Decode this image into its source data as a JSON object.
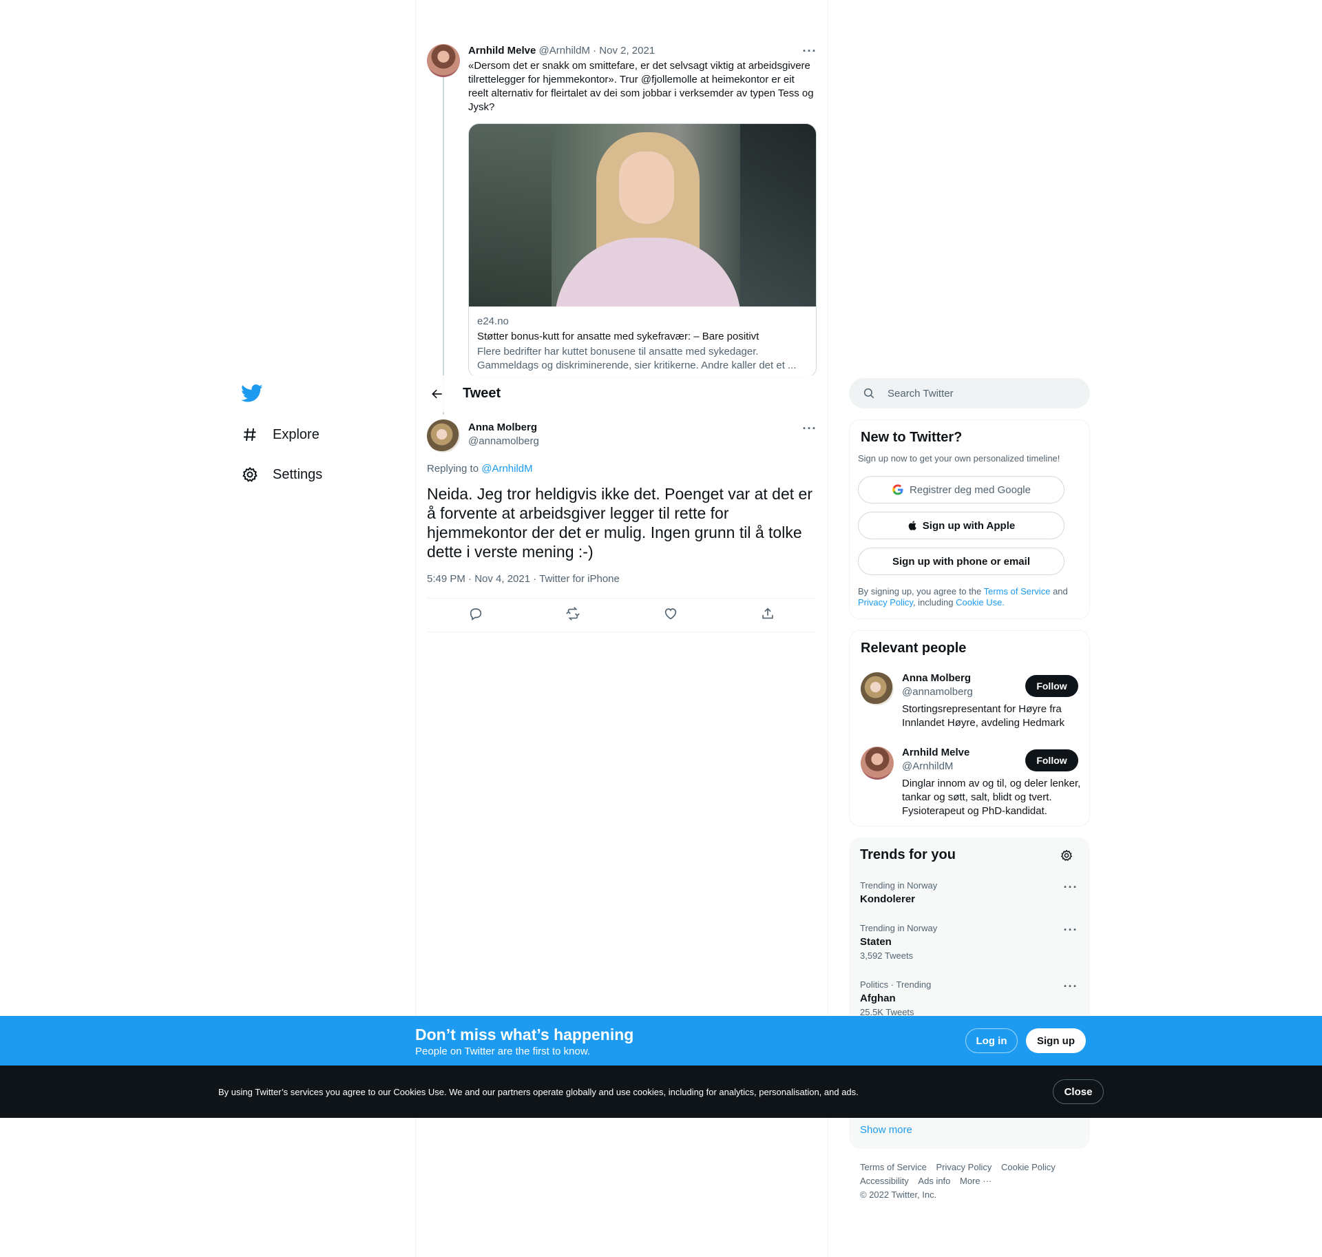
{
  "nav": {
    "explore_label": "Explore",
    "settings_label": "Settings"
  },
  "parent_tweet": {
    "author_name": "Arnhild Melve",
    "handle_date": "@ArnhildM · Nov 2, 2021",
    "text": "«Dersom det er snakk om smittefare, er det selvsagt viktig at arbeidsgivere tilrettelegger for hjemmekontor». Trur @fjollemolle at heimekontor er eit reelt alternativ for fleirtalet av dei som jobbar i verksemder av typen Tess og Jysk?",
    "card": {
      "domain": "e24.no",
      "title": "Støtter bonus-kutt for ansatte med sykefravær: – Bare positivt",
      "description": "Flere bedrifter har kuttet bonusene til ansatte med sykedager. Gammeldags og diskriminerende, sier kritikerne. Andre kaller det et ..."
    }
  },
  "header": {
    "title": "Tweet"
  },
  "focal_tweet": {
    "author_name": "Anna Molberg",
    "handle": "@annamolberg",
    "replying_prefix": "Replying to",
    "replying_to": "@ArnhildM",
    "text": "Neida. Jeg tror heldigvis ikke det. Poenget var at det er å forvente at arbeidsgiver legger til rette for hjemmekontor der det er mulig. Ingen grunn til å tolke dette i verste mening :-)",
    "meta": "5:49 PM · Nov 4, 2021 · Twitter for iPhone"
  },
  "search": {
    "placeholder": "Search Twitter"
  },
  "new_to_twitter": {
    "title": "New to Twitter?",
    "subtitle": "Sign up now to get your own personalized timeline!",
    "google_label": "Registrer deg med Google",
    "apple_label": "Sign up with Apple",
    "phone_label": "Sign up with phone or email",
    "legal_prefix": "By signing up, you agree to the",
    "terms": "Terms of Service",
    "and": "and",
    "privacy": "Privacy Policy",
    "including": ", including",
    "cookie": "Cookie Use."
  },
  "relevant_people": {
    "title": "Relevant people",
    "people": [
      {
        "name": "Anna Molberg",
        "handle": "@annamolberg",
        "bio": "Stortingsrepresentant for Høyre fra Innlandet Høyre, avdeling Hedmark",
        "follow_label": "Follow"
      },
      {
        "name": "Arnhild Melve",
        "handle": "@ArnhildM",
        "bio": "Dinglar innom av og til, og deler lenker, tankar og søtt, salt, blidt og tvert. Fysioterapeut og PhD-kandidat.",
        "follow_label": "Follow"
      }
    ]
  },
  "trends": {
    "title": "Trends for you",
    "items": [
      {
        "context": "Trending in Norway",
        "name": "Kondolerer",
        "count": ""
      },
      {
        "context": "Trending in Norway",
        "name": "Staten",
        "count": "3,592 Tweets"
      },
      {
        "context": "Politics · Trending",
        "name": "Afghan",
        "count": "25.5K Tweets"
      }
    ],
    "show_more": "Show more"
  },
  "footer": {
    "links_row1": [
      "Terms of Service",
      "Privacy Policy",
      "Cookie Policy"
    ],
    "links_row2": [
      "Accessibility",
      "Ads info",
      "More ···"
    ],
    "copyright": "© 2022 Twitter, Inc."
  },
  "signup_banner": {
    "title": "Don’t miss what’s happening",
    "subtitle": "People on Twitter are the first to know.",
    "login_label": "Log in",
    "signup_label": "Sign up"
  },
  "cookie_banner": {
    "text": "By using Twitter’s services you agree to our Cookies Use. We and our partners operate globally and use cookies, including for analytics, personalisation, and ads.",
    "close_label": "Close"
  },
  "colors": {
    "accent": "#1d9bf0",
    "dark": "#0f1419",
    "muted": "#536471"
  }
}
